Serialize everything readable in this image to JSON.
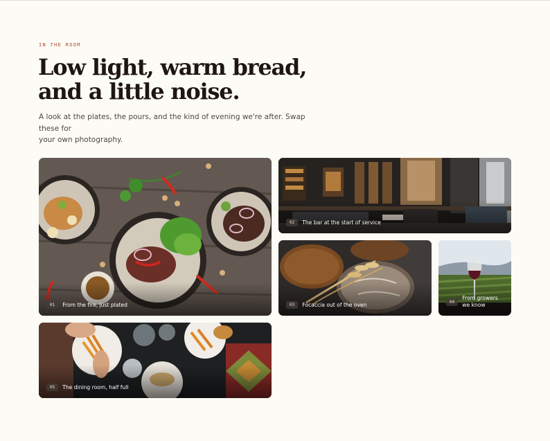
{
  "section": {
    "eyebrow": "IN THE ROOM",
    "title_lines": [
      "Low light, warm bread,",
      "and a little noise."
    ],
    "lede_lines": [
      "A look at the plates, the pours, and the kind of evening we're after. Swap these for",
      "your own photography."
    ]
  },
  "gallery": [
    {
      "number": "01",
      "caption": "From the fire, just plated",
      "photo": "overhead plated dishes on a wooden table"
    },
    {
      "number": "02",
      "caption": "The bar at the start of service",
      "photo": "restaurant bar interior"
    },
    {
      "number": "03",
      "caption": "Focaccia out of the oven",
      "photo": "rustic bread loaves with wheat"
    },
    {
      "number": "04",
      "caption": "From growers we know",
      "photo": "wine glass over a vineyard"
    },
    {
      "number": "05",
      "caption": "The dining room, half full",
      "photo": "overhead shared dinner table"
    }
  ]
}
